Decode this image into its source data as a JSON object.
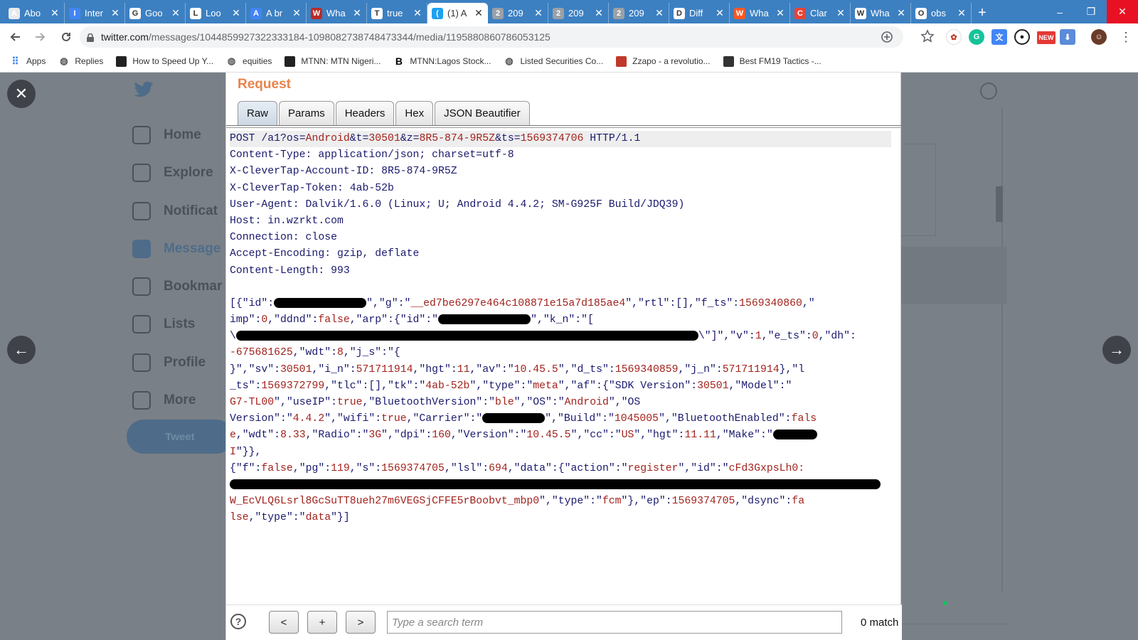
{
  "browser": {
    "tabs": [
      {
        "title": "Abo",
        "icon": "generic-icon",
        "color": "#e8eaed"
      },
      {
        "title": "Inter",
        "icon": "docs-icon",
        "color": "#4285f4"
      },
      {
        "title": "Goo",
        "icon": "wikipedia-icon",
        "color": "#ffffff"
      },
      {
        "title": "Loo",
        "icon": "wikipedia-icon",
        "color": "#ffffff"
      },
      {
        "title": "A br",
        "icon": "docs-icon",
        "color": "#4285f4"
      },
      {
        "title": "Wha",
        "icon": "quora-icon",
        "color": "#b92b27"
      },
      {
        "title": "true",
        "icon": "google-icon",
        "color": "#ffffff"
      },
      {
        "title": "(1) A",
        "icon": "twitter-icon",
        "color": "#1da1f2",
        "active": true
      },
      {
        "title": "209",
        "icon": "globe-icon",
        "color": "#9aa0a6"
      },
      {
        "title": "209",
        "icon": "globe-icon",
        "color": "#9aa0a6"
      },
      {
        "title": "209",
        "icon": "globe-icon",
        "color": "#9aa0a6"
      },
      {
        "title": "Diff",
        "icon": "diamond-icon",
        "color": "#ffffff"
      },
      {
        "title": "Wha",
        "icon": "blogger-icon",
        "color": "#ff5722"
      },
      {
        "title": "Clar",
        "icon": "gmail-icon",
        "color": "#ea4335"
      },
      {
        "title": "Wha",
        "icon": "api-icon",
        "color": "#ffffff"
      },
      {
        "title": "obs",
        "icon": "google-icon",
        "color": "#ffffff"
      }
    ],
    "new_tab": "+",
    "window_controls": {
      "minimize": "–",
      "maximize": "❐",
      "close": "✕"
    },
    "url_host": "twitter.com",
    "url_path": "/messages/1044859927322333184-1098082738748473344/media/1195880860786053125",
    "bookmarks": [
      {
        "label": "Apps",
        "icon": "apps-icon"
      },
      {
        "label": "Replies",
        "icon": "globe-icon"
      },
      {
        "label": "How to Speed Up Y...",
        "icon": "speed-icon"
      },
      {
        "label": "equities",
        "icon": "globe-icon"
      },
      {
        "label": "MTNN: MTN Nigeri...",
        "icon": "investing-icon"
      },
      {
        "label": "MTNN:Lagos Stock...",
        "icon": "bloomberg-icon"
      },
      {
        "label": "Listed Securities Co...",
        "icon": "globe-icon"
      },
      {
        "label": "Zzapo - a revolutio...",
        "icon": "flag-icon"
      },
      {
        "label": "Best FM19 Tactics -...",
        "icon": "football-icon"
      }
    ],
    "extensions": [
      "zoom-icon",
      "star-icon",
      "ext-icon",
      "grammarly-icon",
      "translate-icon",
      "soccer-icon",
      "new-badge-icon",
      "download-icon",
      "avatar",
      "menu-icon"
    ]
  },
  "twitter": {
    "nav": [
      "Home",
      "Explore",
      "Notificat",
      "Message",
      "Bookmar",
      "Lists",
      "Profile",
      "More"
    ],
    "active_nav": "Message",
    "tweet_button": "Tweet",
    "close": "✕",
    "prev": "←",
    "next": "→"
  },
  "burp": {
    "title": "Request",
    "tabs": [
      "Raw",
      "Params",
      "Headers",
      "Hex",
      "JSON Beautifier"
    ],
    "active_tab": "Raw",
    "request_line": {
      "method": "POST /a1?",
      "params": [
        {
          "k": "os",
          "v": "Android"
        },
        {
          "k": "t",
          "v": "30501"
        },
        {
          "k": "z",
          "v": "8R5-874-9R5Z"
        },
        {
          "k": "ts",
          "v": "1569374706"
        }
      ],
      "version": " HTTP/1.1"
    },
    "headers": [
      "Content-Type: application/json; charset=utf-8",
      "X-CleverTap-Account-ID: 8R5-874-9R5Z",
      "X-CleverTap-Token: 4ab-52b",
      "User-Agent: Dalvik/1.6.0 (Linux; U; Android 4.4.2; SM-G925F Build/JDQ39)",
      "Host: in.wzrkt.com",
      "Connection: close",
      "Accept-Encoding: gzip, deflate",
      "Content-Length: 993"
    ],
    "body": [
      [
        [
          "k",
          "[{\"id\":"
        ],
        [
          "r",
          ""
        ],
        [
          "k",
          "\",\"g\":\""
        ],
        [
          "v",
          "__ed7be6297e464c108871e15a7d185ae4"
        ],
        [
          "k",
          "\",\"rtl\":[],\"f_ts\":"
        ],
        [
          "v",
          "1569340860"
        ],
        [
          "k",
          ",\""
        ]
      ],
      [
        [
          "k",
          "imp\":"
        ],
        [
          "v",
          "0"
        ],
        [
          "k",
          ",\"ddnd\":"
        ],
        [
          "v",
          "false"
        ],
        [
          "k",
          ",\"arp\":{\"id\":\""
        ],
        [
          "r",
          ""
        ],
        [
          "k",
          "\",\"k_n\":\"["
        ]
      ],
      [
        [
          "k",
          "\\"
        ],
        [
          "r",
          ""
        ],
        [
          "k",
          "\\\"]\",\"v\":"
        ],
        [
          "v",
          "1"
        ],
        [
          "k",
          ",\"e_ts\":"
        ],
        [
          "v",
          "0"
        ],
        [
          "k",
          ",\"dh\":"
        ]
      ],
      [
        [
          "v",
          "-675681625"
        ],
        [
          "k",
          ",\"wdt\":"
        ],
        [
          "v",
          "8"
        ],
        [
          "k",
          ",\"j_s\":\"{"
        ]
      ],
      [
        [
          "k",
          "}\",\"sv\":"
        ],
        [
          "v",
          "30501"
        ],
        [
          "k",
          ",\"i_n\":"
        ],
        [
          "v",
          "571711914"
        ],
        [
          "k",
          ",\"hgt\":"
        ],
        [
          "v",
          "11"
        ],
        [
          "k",
          ",\"av\":\""
        ],
        [
          "v",
          "10.45.5"
        ],
        [
          "k",
          "\",\"d_ts\":"
        ],
        [
          "v",
          "1569340859"
        ],
        [
          "k",
          ",\"j_n\":"
        ],
        [
          "v",
          "571711914"
        ],
        [
          "k",
          "},\"l"
        ]
      ],
      [
        [
          "k",
          "_ts\":"
        ],
        [
          "v",
          "1569372799"
        ],
        [
          "k",
          ",\"tlc\":[],\"tk\":\""
        ],
        [
          "v",
          "4ab-52b"
        ],
        [
          "k",
          "\",\"type\":\""
        ],
        [
          "v",
          "meta"
        ],
        [
          "k",
          "\",\"af\":{\"SDK Version\":"
        ],
        [
          "v",
          "30501"
        ],
        [
          "k",
          ",\"Model\":\""
        ]
      ],
      [
        [
          "v",
          "G7-TL00"
        ],
        [
          "k",
          "\",\"useIP\":"
        ],
        [
          "v",
          "true"
        ],
        [
          "k",
          ",\"BluetoothVersion\":\""
        ],
        [
          "v",
          "ble"
        ],
        [
          "k",
          "\",\"OS\":\""
        ],
        [
          "v",
          "Android"
        ],
        [
          "k",
          "\",\"OS"
        ]
      ],
      [
        [
          "k",
          "Version\":\""
        ],
        [
          "v",
          "4.4.2"
        ],
        [
          "k",
          "\",\"wifi\":"
        ],
        [
          "v",
          "true"
        ],
        [
          "k",
          ",\"Carrier\":\""
        ],
        [
          "r",
          ""
        ],
        [
          "k",
          "\",\"Build\":\""
        ],
        [
          "v",
          "1045005"
        ],
        [
          "k",
          "\",\"BluetoothEnabled\":"
        ],
        [
          "v",
          "fals"
        ]
      ],
      [
        [
          "v",
          "e"
        ],
        [
          "k",
          ",\"wdt\":"
        ],
        [
          "v",
          "8.33"
        ],
        [
          "k",
          ",\"Radio\":\""
        ],
        [
          "v",
          "3G"
        ],
        [
          "k",
          "\",\"dpi\":"
        ],
        [
          "v",
          "160"
        ],
        [
          "k",
          ",\"Version\":\""
        ],
        [
          "v",
          "10.45.5"
        ],
        [
          "k",
          "\",\"cc\":\""
        ],
        [
          "v",
          "US"
        ],
        [
          "k",
          "\",\"hgt\":"
        ],
        [
          "v",
          "11.11"
        ],
        [
          "k",
          ",\"Make\":\""
        ],
        [
          "r",
          ""
        ]
      ],
      [
        [
          "v",
          "I"
        ],
        [
          "k",
          "\"}},"
        ]
      ],
      [
        [
          "k",
          "{\"f\":"
        ],
        [
          "v",
          "false"
        ],
        [
          "k",
          ",\"pg\":"
        ],
        [
          "v",
          "119"
        ],
        [
          "k",
          ",\"s\":"
        ],
        [
          "v",
          "1569374705"
        ],
        [
          "k",
          ",\"lsl\":"
        ],
        [
          "v",
          "694"
        ],
        [
          "k",
          ",\"data\":{\"action\":\""
        ],
        [
          "v",
          "register"
        ],
        [
          "k",
          "\",\"id\":\""
        ],
        [
          "v",
          "cFd3GxpsLh0:"
        ]
      ],
      [
        [
          "r",
          ""
        ]
      ],
      [
        [
          "v",
          "W_EcVLQ6Lsrl8GcSuTT8ueh27m6VEGSjCFFE5rBoobvt_mbp0"
        ],
        [
          "k",
          "\",\"type\":\""
        ],
        [
          "v",
          "fcm"
        ],
        [
          "k",
          "\"},\"ep\":"
        ],
        [
          "v",
          "1569374705"
        ],
        [
          "k",
          ",\"dsync\":"
        ],
        [
          "v",
          "fa"
        ]
      ],
      [
        [
          "v",
          "lse"
        ],
        [
          "k",
          ",\"type\":\""
        ],
        [
          "v",
          "data"
        ],
        [
          "k",
          "\"}]"
        ]
      ]
    ],
    "help": "?",
    "prev_button": "<",
    "add_button": "+",
    "next_button": ">",
    "search_placeholder": "Type a search term",
    "matches": "0 match"
  }
}
